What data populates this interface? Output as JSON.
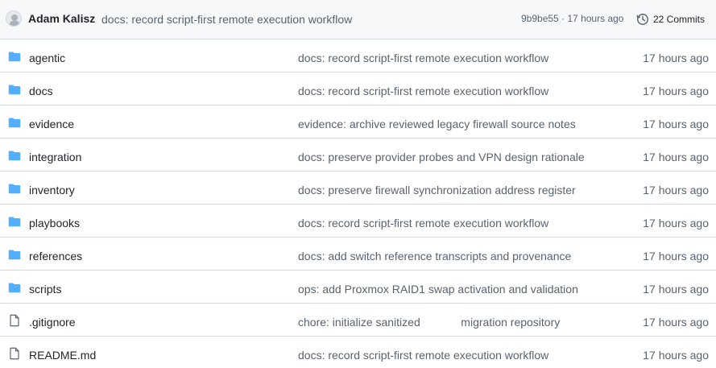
{
  "commit": {
    "author": "Adam Kalisz",
    "message": "docs: record script-first remote execution workflow",
    "meta": "9b9be55 · 17 hours ago",
    "commits_label": "22 Commits"
  },
  "colors": {
    "folder": "#54aeff",
    "text_muted": "#59636e",
    "border": "#d1d9e0"
  },
  "files": [
    {
      "type": "folder",
      "icon": "folder-icon",
      "name": "agentic",
      "message": "docs: record script-first remote execution workflow",
      "age": "17 hours ago"
    },
    {
      "type": "folder",
      "icon": "folder-icon",
      "name": "docs",
      "message": "docs: record script-first remote execution workflow",
      "age": "17 hours ago"
    },
    {
      "type": "folder",
      "icon": "folder-icon",
      "name": "evidence",
      "message": "evidence: archive reviewed legacy firewall source notes",
      "age": "17 hours ago"
    },
    {
      "type": "folder",
      "icon": "folder-icon",
      "name": "integration",
      "message": "docs: preserve provider probes and VPN design rationale",
      "age": "17 hours ago"
    },
    {
      "type": "folder",
      "icon": "folder-icon",
      "name": "inventory",
      "message": "docs: preserve firewall synchronization address register",
      "age": "17 hours ago"
    },
    {
      "type": "folder",
      "icon": "folder-icon",
      "name": "playbooks",
      "message": "docs: record script-first remote execution workflow",
      "age": "17 hours ago"
    },
    {
      "type": "folder",
      "icon": "folder-icon",
      "name": "references",
      "message": "docs: add switch reference transcripts and provenance",
      "age": "17 hours ago"
    },
    {
      "type": "folder",
      "icon": "folder-icon",
      "name": "scripts",
      "message": "ops: add Proxmox RAID1 swap activation and validation",
      "age": "17 hours ago"
    },
    {
      "type": "file",
      "icon": "file-icon",
      "name": ".gitignore",
      "message": "chore: initialize sanitized             migration repository",
      "age": "17 hours ago"
    },
    {
      "type": "file",
      "icon": "file-icon",
      "name": "README.md",
      "message": "docs: record script-first remote execution workflow",
      "age": "17 hours ago"
    }
  ]
}
